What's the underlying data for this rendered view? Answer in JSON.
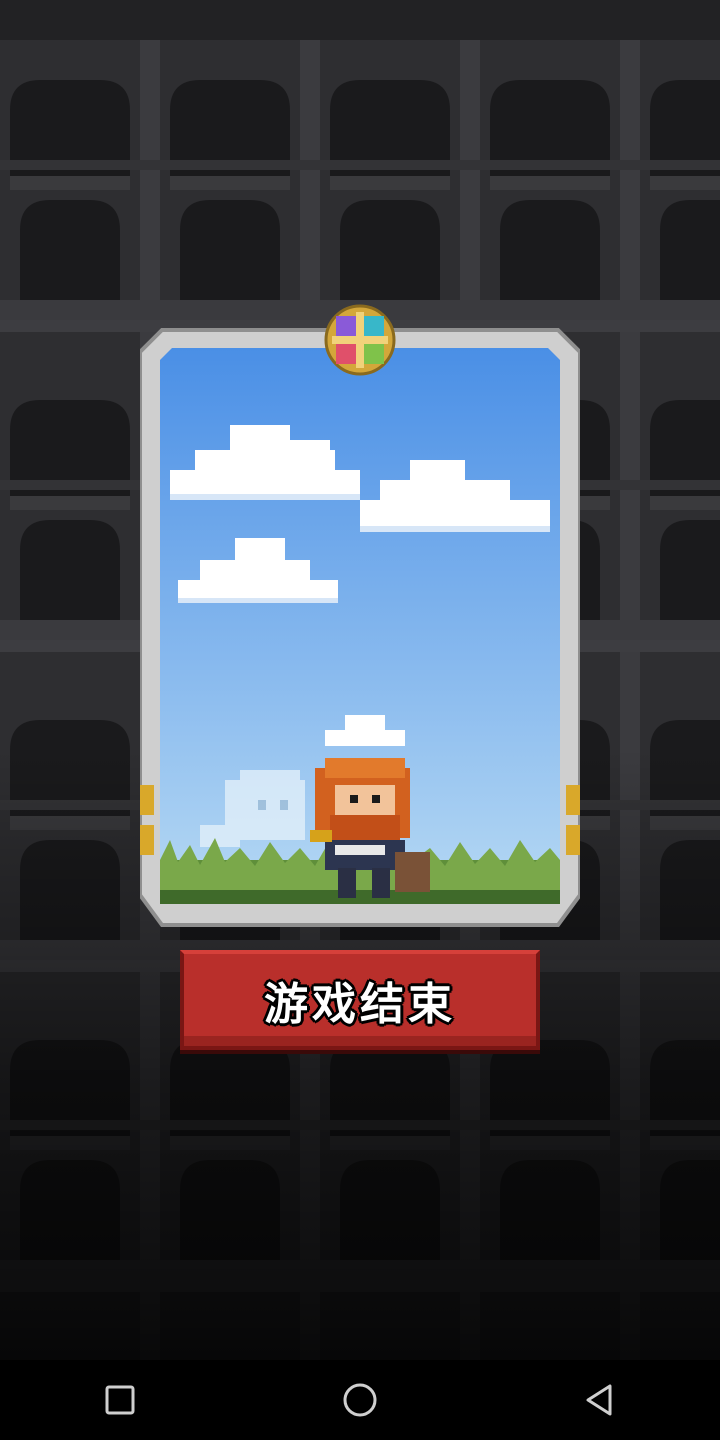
{
  "game_over_button": {
    "label": "游戏结束"
  },
  "card": {
    "character": "red-bearded-warrior",
    "frame_gem": "four-color-emblem"
  },
  "navbar": {
    "recent_icon": "square-icon",
    "home_icon": "circle-icon",
    "back_icon": "triangle-back-icon"
  },
  "colors": {
    "wall": "#2a2a2c",
    "sky_top": "#4a8fe6",
    "sky_bottom": "#a7cff2",
    "button": "#b92f2b",
    "frame": "#c9c9c9"
  }
}
